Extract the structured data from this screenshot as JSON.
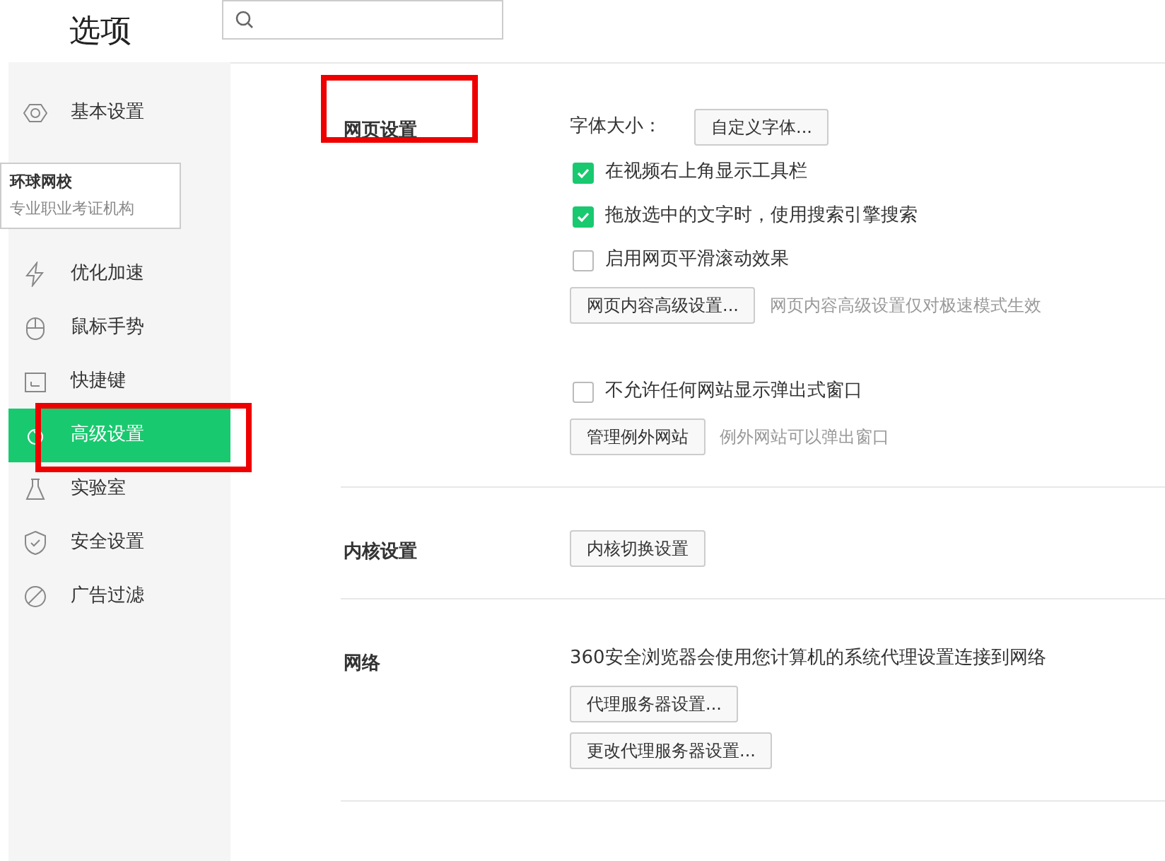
{
  "header": {
    "title": "选项"
  },
  "sidebar": {
    "items": [
      {
        "kind": "item",
        "label": "基本设置",
        "selected": false
      },
      {
        "kind": "covered"
      },
      {
        "kind": "covered"
      },
      {
        "kind": "item",
        "label": "优化加速",
        "selected": false
      },
      {
        "kind": "item",
        "label": "鼠标手势",
        "selected": false
      },
      {
        "kind": "item",
        "label": "快捷键",
        "selected": false
      },
      {
        "kind": "item",
        "label": "高级设置",
        "selected": true,
        "highlighted": true
      },
      {
        "kind": "item",
        "label": "实验室",
        "selected": false
      },
      {
        "kind": "item",
        "label": "安全设置",
        "selected": false
      },
      {
        "kind": "item",
        "label": "广告过滤",
        "selected": false
      }
    ]
  },
  "tooltip": {
    "title": "环球网校",
    "subtitle": "专业职业考证机构"
  },
  "sections": [
    {
      "title": "网页设置",
      "highlighted": true,
      "rows": [
        {
          "kind": "label-button",
          "label": "字体大小：",
          "button": "自定义字体..."
        },
        {
          "kind": "checkbox",
          "label": "在视频右上角显示工具栏",
          "checked": true
        },
        {
          "kind": "checkbox",
          "label": "拖放选中的文字时，使用搜索引擎搜索",
          "checked": true
        },
        {
          "kind": "checkbox",
          "label": "启用网页平滑滚动效果",
          "checked": false
        },
        {
          "kind": "button",
          "button": "网页内容高级设置...",
          "note": "网页内容高级设置仅对极速模式生效"
        },
        {
          "kind": "spacer"
        },
        {
          "kind": "checkbox",
          "label": "不允许任何网站显示弹出式窗口",
          "checked": false
        },
        {
          "kind": "button",
          "button": "管理例外网站",
          "note": "例外网站可以弹出窗口"
        }
      ]
    },
    {
      "title": "内核设置",
      "rows": [
        {
          "kind": "button",
          "button": "内核切换设置"
        }
      ]
    },
    {
      "title": "网络",
      "rows": [
        {
          "kind": "text",
          "text": "360安全浏览器会使用您计算机的系统代理设置连接到网络"
        },
        {
          "kind": "button",
          "button": "代理服务器设置..."
        },
        {
          "kind": "button",
          "button": "更改代理服务器设置..."
        }
      ]
    }
  ]
}
